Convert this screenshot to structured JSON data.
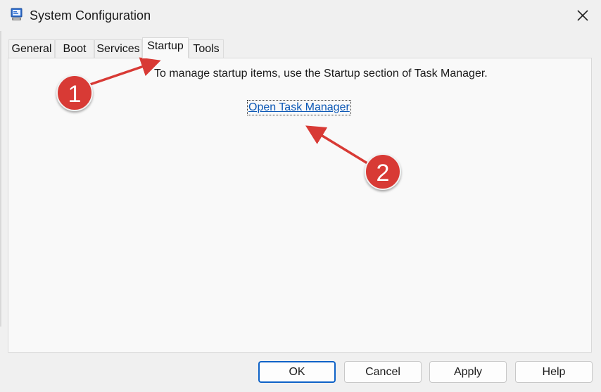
{
  "window": {
    "title": "System Configuration",
    "icon": "msconfig-app-icon",
    "close_glyph": "✕"
  },
  "tabs": [
    {
      "label": "General",
      "active": false
    },
    {
      "label": "Boot",
      "active": false
    },
    {
      "label": "Services",
      "active": false
    },
    {
      "label": "Startup",
      "active": true
    },
    {
      "label": "Tools",
      "active": false
    }
  ],
  "startup_panel": {
    "instruction": "To manage startup items, use the Startup section of Task Manager.",
    "link_label": "Open Task Manager"
  },
  "buttons": {
    "ok": "OK",
    "cancel": "Cancel",
    "apply": "Apply",
    "help": "Help"
  },
  "annotations": {
    "badge_1": "1",
    "badge_2": "2",
    "color": "#d83a35"
  },
  "colors": {
    "link": "#0b57b5",
    "default_button_border": "#0e62c7"
  }
}
